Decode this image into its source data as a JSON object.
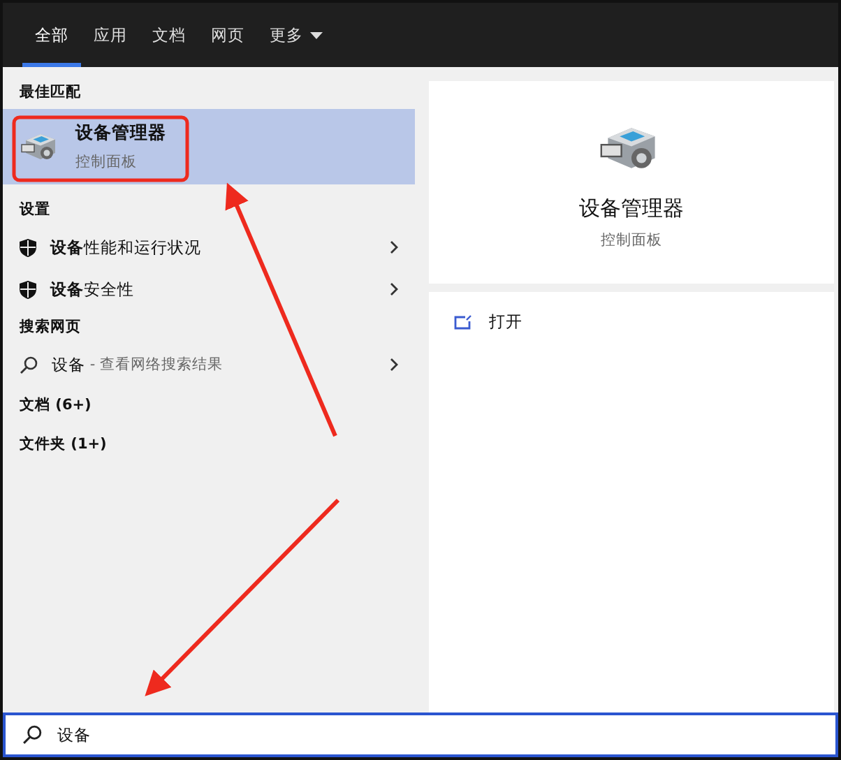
{
  "tabs": [
    {
      "label": "全部",
      "selected": true
    },
    {
      "label": "应用",
      "selected": false
    },
    {
      "label": "文档",
      "selected": false
    },
    {
      "label": "网页",
      "selected": false
    },
    {
      "label": "更多",
      "selected": false,
      "dropdown": true
    }
  ],
  "best_match": {
    "heading": "最佳匹配",
    "title": "设备管理器",
    "subtitle": "控制面板",
    "selected": true
  },
  "settings": {
    "heading": "设置",
    "items": [
      {
        "label": "**设备**性能和运行状况"
      },
      {
        "label": "**设备**安全性"
      }
    ]
  },
  "web": {
    "heading": "搜索网页",
    "query": "设备",
    "hint": " - 查看网络搜索结果"
  },
  "groups": [
    {
      "label": "文档 (6+)"
    },
    {
      "label": "文件夹 (1+)"
    }
  ],
  "preview": {
    "title": "设备管理器",
    "subtitle": "控制面板",
    "actions": [
      {
        "label": "打开"
      }
    ]
  },
  "search": {
    "value": "设备"
  }
}
